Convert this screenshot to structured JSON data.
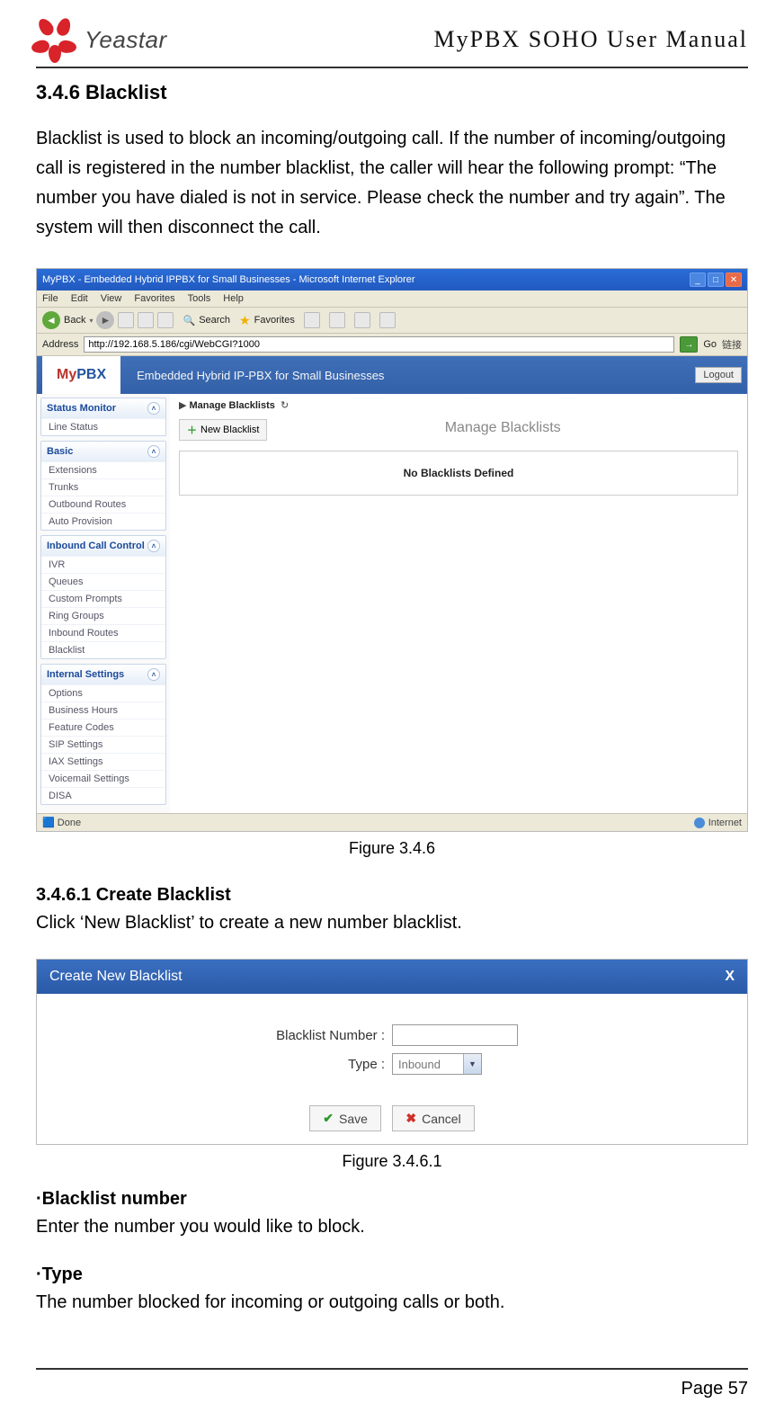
{
  "header": {
    "brand": "Yeastar",
    "docTitle": "MyPBX SOHO User Manual"
  },
  "section": {
    "heading": "3.4.6 Blacklist",
    "intro": "Blacklist is used to block an incoming/outgoing call. If the number of incoming/outgoing call is registered in the number blacklist, the caller will hear the following prompt: “The number you have dialed is not in service. Please check the number and try again”. The system will then disconnect the call."
  },
  "fig346": {
    "windowTitle": "MyPBX - Embedded Hybrid IPPBX for Small Businesses - Microsoft Internet Explorer",
    "menu": [
      "File",
      "Edit",
      "View",
      "Favorites",
      "Tools",
      "Help"
    ],
    "tbBack": "Back",
    "tbSearch": "Search",
    "tbFav": "Favorites",
    "addrLabel": "Address",
    "addrValue": "http://192.168.5.186/cgi/WebCGI?1000",
    "goLabel": "Go",
    "linkLabel": "链接",
    "brandMy": "My",
    "brandPBX": "PBX",
    "embedded": "Embedded Hybrid IP-PBX for Small Businesses",
    "logout": "Logout",
    "side": {
      "statusMonitor": "Status Monitor",
      "lineStatus": "Line Status",
      "basic": "Basic",
      "extensions": "Extensions",
      "trunks": "Trunks",
      "outboundRoutes": "Outbound Routes",
      "autoProvision": "Auto Provision",
      "inboundCallControl": "Inbound Call Control",
      "ivr": "IVR",
      "queues": "Queues",
      "customPrompts": "Custom Prompts",
      "ringGroups": "Ring Groups",
      "inboundRoutes": "Inbound Routes",
      "blacklist": "Blacklist",
      "internalSettings": "Internal Settings",
      "options": "Options",
      "businessHours": "Business Hours",
      "featureCodes": "Feature Codes",
      "sipSettings": "SIP Settings",
      "iaxSettings": "IAX Settings",
      "voicemailSettings": "Voicemail Settings",
      "disa": "DISA"
    },
    "breadcrumb": "Manage Blacklists",
    "pageTitle": "Manage Blacklists",
    "newBlacklist": "New Blacklist",
    "noDefined": "No Blacklists Defined",
    "statusDone": "Done",
    "statusNet": "Internet",
    "caption": "Figure 3.4.6"
  },
  "sub": {
    "heading": "3.4.6.1 Create Blacklist",
    "text": "Click ‘New Blacklist’ to create a new number blacklist."
  },
  "fig3461": {
    "title": "Create New Blacklist",
    "close": "X",
    "numberLabel": "Blacklist Number :",
    "typeLabel": "Type :",
    "typeValue": "Inbound",
    "save": "Save",
    "cancel": "Cancel",
    "caption": "Figure 3.4.6.1"
  },
  "fields": {
    "bnHead": "·Blacklist number",
    "bnText": "Enter the number you would like to block.",
    "typeHead": "·Type",
    "typeText": "The number blocked for incoming or outgoing calls or both."
  },
  "footer": {
    "page": "Page 57"
  }
}
